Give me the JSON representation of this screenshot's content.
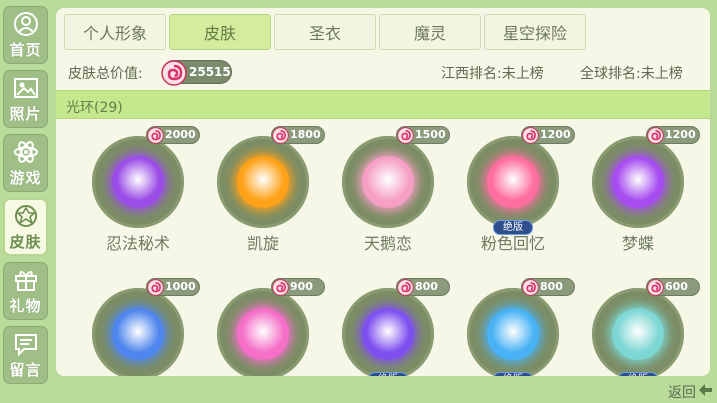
{
  "sidebar": {
    "items": [
      {
        "label": "首页",
        "icon": "user-icon"
      },
      {
        "label": "照片",
        "icon": "photo-icon"
      },
      {
        "label": "游戏",
        "icon": "atom-icon"
      },
      {
        "label": "皮肤",
        "icon": "badge-icon",
        "active": true
      },
      {
        "label": "礼物",
        "icon": "gift-icon"
      },
      {
        "label": "留言",
        "icon": "message-icon"
      }
    ]
  },
  "tabs": [
    {
      "label": "个人形象"
    },
    {
      "label": "皮肤",
      "active": true
    },
    {
      "label": "圣衣"
    },
    {
      "label": "魔灵"
    },
    {
      "label": "星空探险"
    }
  ],
  "info": {
    "total_label": "皮肤总价值:",
    "total_value": "25515",
    "rank_province": "江西排名:未上榜",
    "rank_global": "全球排名:未上榜"
  },
  "category": {
    "label": "光环(29)"
  },
  "items": [
    {
      "name": "忍法秘术",
      "price": "2000",
      "color": "#9b4de8"
    },
    {
      "name": "凯旋",
      "price": "1800",
      "color": "#ffa21a"
    },
    {
      "name": "天鹅恋",
      "price": "1500",
      "color": "#f5a0c4"
    },
    {
      "name": "粉色回忆",
      "price": "1200",
      "color": "#ff6ea0",
      "badge": "绝版"
    },
    {
      "name": "梦蝶",
      "price": "1200",
      "color": "#a64cf0"
    },
    {
      "name": "",
      "price": "1000",
      "color": "#4f86ee"
    },
    {
      "name": "",
      "price": "900",
      "color": "#f56fc8"
    },
    {
      "name": "",
      "price": "800",
      "color": "#7f50f0",
      "badge": "绝版"
    },
    {
      "name": "",
      "price": "800",
      "color": "#48b2f5",
      "badge": "绝版"
    },
    {
      "name": "",
      "price": "600",
      "color": "#7dd7d4",
      "badge": "绝版"
    }
  ],
  "back": {
    "label": "返回"
  }
}
